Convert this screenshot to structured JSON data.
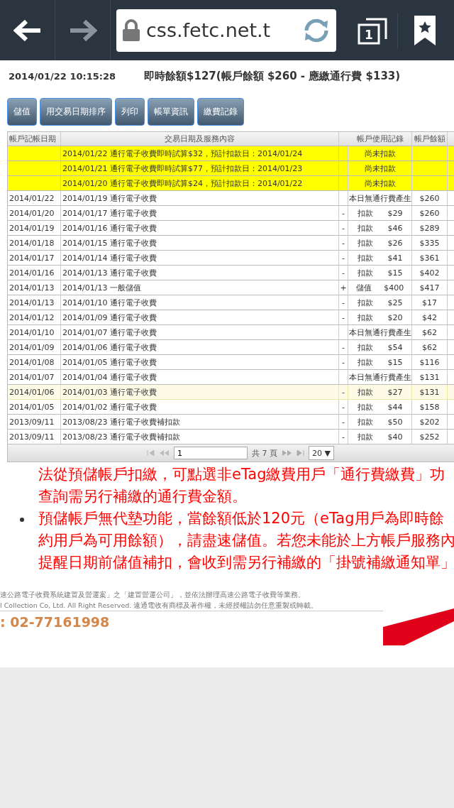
{
  "browser": {
    "url": "css.fetc.net.t",
    "tab_count": "1"
  },
  "header": {
    "timestamp": "2014/01/22 10:15:28",
    "summary": "即時餘額$127(帳戶餘額 $260 - 應繳通行費 $133)"
  },
  "buttons": [
    "儲值",
    "用交易日期排序",
    "列印",
    "帳單資訊",
    "繳費記錄"
  ],
  "table": {
    "columns": [
      "帳戶記帳日期",
      "交易日期及服務內容",
      "帳戶使用記錄",
      "帳戶餘額"
    ],
    "rows": [
      {
        "kind": "pending",
        "highlighted": false,
        "content": "2014/01/22 通行電子收費即時試算$32，預計扣款日：2014/01/24",
        "note": "尚未扣款"
      },
      {
        "kind": "pending",
        "highlighted": false,
        "content": "2014/01/21 通行電子收費即時試算$77，預計扣款日：2014/01/23",
        "note": "尚未扣款"
      },
      {
        "kind": "pending",
        "highlighted": false,
        "content": "2014/01/20 通行電子收費即時試算$24，預計扣款日：2014/01/22",
        "note": "尚未扣款"
      },
      {
        "kind": "note",
        "highlighted": false,
        "date": "2014/01/22",
        "content": "2014/01/19 通行電子收費",
        "note": "本日無通行費產生",
        "balance": "$260"
      },
      {
        "kind": "entry",
        "highlighted": false,
        "date": "2014/01/20",
        "content": "2014/01/17 通行電子收費",
        "sign": "-",
        "type": "扣款",
        "amount": "$29",
        "balance": "$260"
      },
      {
        "kind": "entry",
        "highlighted": false,
        "date": "2014/01/19",
        "content": "2014/01/16 通行電子收費",
        "sign": "-",
        "type": "扣款",
        "amount": "$46",
        "balance": "$289"
      },
      {
        "kind": "entry",
        "highlighted": false,
        "date": "2014/01/18",
        "content": "2014/01/15 通行電子收費",
        "sign": "-",
        "type": "扣款",
        "amount": "$26",
        "balance": "$335"
      },
      {
        "kind": "entry",
        "highlighted": false,
        "date": "2014/01/17",
        "content": "2014/01/14 通行電子收費",
        "sign": "-",
        "type": "扣款",
        "amount": "$41",
        "balance": "$361"
      },
      {
        "kind": "entry",
        "highlighted": false,
        "date": "2014/01/16",
        "content": "2014/01/13 通行電子收費",
        "sign": "-",
        "type": "扣款",
        "amount": "$15",
        "balance": "$402"
      },
      {
        "kind": "entry",
        "highlighted": false,
        "date": "2014/01/13",
        "content": "2014/01/13 一般儲值",
        "sign": "+",
        "type": "儲值",
        "amount": "$400",
        "balance": "$417"
      },
      {
        "kind": "entry",
        "highlighted": false,
        "date": "2014/01/13",
        "content": "2014/01/10 通行電子收費",
        "sign": "-",
        "type": "扣款",
        "amount": "$25",
        "balance": "$17"
      },
      {
        "kind": "entry",
        "highlighted": false,
        "date": "2014/01/12",
        "content": "2014/01/09 通行電子收費",
        "sign": "-",
        "type": "扣款",
        "amount": "$20",
        "balance": "$42"
      },
      {
        "kind": "note",
        "highlighted": false,
        "date": "2014/01/10",
        "content": "2014/01/07 通行電子收費",
        "note": "本日無通行費產生",
        "balance": "$62"
      },
      {
        "kind": "entry",
        "highlighted": false,
        "date": "2014/01/09",
        "content": "2014/01/06 通行電子收費",
        "sign": "-",
        "type": "扣款",
        "amount": "$54",
        "balance": "$62"
      },
      {
        "kind": "entry",
        "highlighted": false,
        "date": "2014/01/08",
        "content": "2014/01/05 通行電子收費",
        "sign": "-",
        "type": "扣款",
        "amount": "$15",
        "balance": "$116"
      },
      {
        "kind": "note",
        "highlighted": false,
        "date": "2014/01/07",
        "content": "2014/01/04 通行電子收費",
        "note": "本日無通行費產生",
        "balance": "$131"
      },
      {
        "kind": "entry",
        "highlighted": true,
        "date": "2014/01/06",
        "content": "2014/01/03 通行電子收費",
        "sign": "-",
        "type": "扣款",
        "amount": "$27",
        "balance": "$131"
      },
      {
        "kind": "entry",
        "highlighted": false,
        "date": "2014/01/05",
        "content": "2014/01/02 通行電子收費",
        "sign": "-",
        "type": "扣款",
        "amount": "$44",
        "balance": "$158"
      },
      {
        "kind": "entry",
        "highlighted": false,
        "date": "2013/09/11",
        "content": "2013/08/23 通行電子收費補扣款",
        "sign": "-",
        "type": "扣款",
        "amount": "$50",
        "balance": "$202"
      },
      {
        "kind": "entry",
        "highlighted": false,
        "date": "2013/09/11",
        "content": "2013/08/23 通行電子收費補扣款",
        "sign": "-",
        "type": "扣款",
        "amount": "$40",
        "balance": "$252"
      }
    ]
  },
  "pager": {
    "page": "1",
    "total": "共 7 頁",
    "page_size": "20 ▼"
  },
  "notices": [
    {
      "bullet": false,
      "lines": [
        "法從預儲帳戶扣繳，可點選非eTag繳費用戶「通行費繳費」功",
        "查詢需另行補繳的通行費金額。"
      ]
    },
    {
      "bullet": true,
      "lines": [
        "預儲帳戶無代墊功能，當餘額低於120元（eTag用戶為即時餘",
        "約用戶為可用餘額），請盡速儲值。若您未能於上方帳戶服務內",
        "提醒日期前儲值補扣，會收到需另行補繳的「掛號補繳通知單」"
      ]
    }
  ],
  "footer": {
    "lines": [
      "速公路電子收費系統建置及營運案」之「建置營運公司」，並依法辦理高速公路電子收費等業務。",
      "l Collection Co, Ltd. All Right Reserved. 遠通電收有商標及著作權，未經授權請勿任意重製或轉載。"
    ],
    "phone": ": 02-77161998"
  }
}
